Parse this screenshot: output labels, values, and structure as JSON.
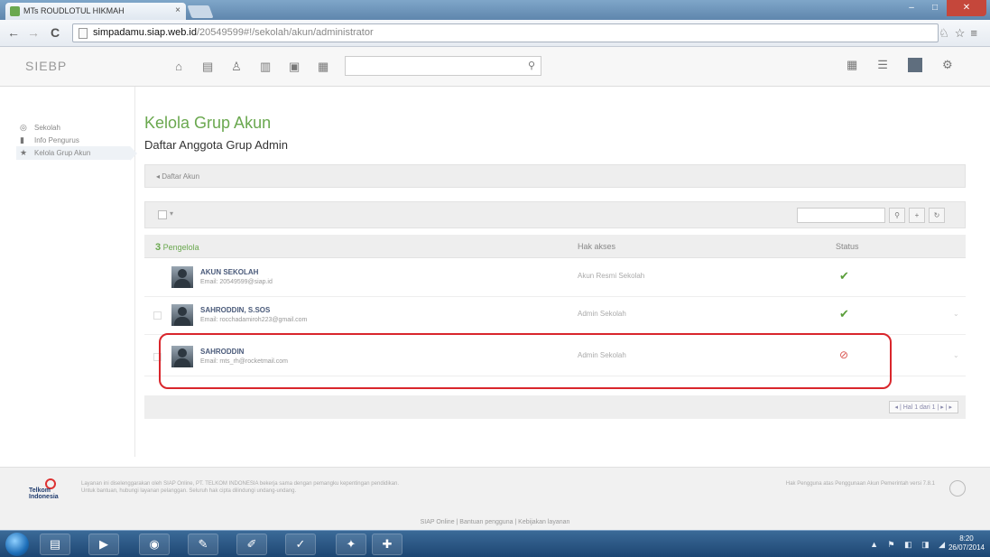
{
  "browser": {
    "tab_title": "MTs ROUDLOTUL HIKMAH",
    "tab_close": "×",
    "url_domain": "simpadamu.siap.web.id",
    "url_path": "/20549599#!/sekolah/akun/administrator",
    "nav_back": "←",
    "nav_forward": "→",
    "nav_reload": "C",
    "toolbar_right": "♘☆≡",
    "win_min": "–",
    "win_max": "□",
    "win_close": "✕"
  },
  "app": {
    "logo": "SIEBP",
    "nav_icons": [
      "home-icon",
      "book-icon",
      "users-icon",
      "calendar-icon",
      "document-icon",
      "building-icon"
    ],
    "nav_glyphs": [
      "⌂",
      "▤",
      "♙",
      "▥",
      "▣",
      "▦"
    ],
    "search_icon": "⚲",
    "right_glyphs": [
      "▦",
      "☰",
      "⚙"
    ]
  },
  "sidebar": {
    "items": [
      {
        "label": "Sekolah",
        "glyph": "◎"
      },
      {
        "label": "Info Pengurus",
        "glyph": "▮"
      },
      {
        "label": "Kelola Grup Akun",
        "glyph": "★"
      }
    ]
  },
  "main": {
    "title": "Kelola Grup Akun",
    "subtitle": "Daftar Anggota Grup Admin",
    "breadcrumb": "◂ Daftar Akun",
    "filter_buttons": [
      "⚲",
      "+",
      "↻"
    ],
    "table": {
      "count_number": "3",
      "count_label": "Pengelola",
      "col_role": "Hak akses",
      "col_status": "Status",
      "rows": [
        {
          "name": "AKUN SEKOLAH",
          "email": "Email: 20549599@siap.id",
          "role": "Akun Resmi Sekolah",
          "status": "✔",
          "status_kind": "ok",
          "menu": ""
        },
        {
          "name": "SAHRODDIN, S.SOS",
          "email": "Email: rocchadamiroh223@gmail.com",
          "role": "Admin Sekolah",
          "status": "✔",
          "status_kind": "ok",
          "menu": "⌄"
        },
        {
          "name": "SAHRODDIN",
          "email": "Email: mts_rh@rocketmail.com",
          "role": "Admin Sekolah",
          "status": "⊘",
          "status_kind": "bad",
          "menu": "⌄"
        }
      ]
    },
    "pager": "◂ | Hal 1 dari 1 | ▸ | ▸"
  },
  "footer": {
    "logo_text": "Telkom Indonesia",
    "text": "Layanan ini diselenggarakan oleh SIAP Online, PT. TELKOM INDONESIA bekerja sama dengan pemangku kepentingan pendidikan. Untuk bantuan, hubungi layanan pelanggan. Seluruh hak cipta dilindungi undang-undang.",
    "right_text": "Hak Pengguna atas Penggunaan Akun Pemerintah versi 7.8.1",
    "links": "SIAP Online | Bantuan pengguna | Kebijakan layanan"
  },
  "taskbar": {
    "apps": [
      "folder-icon",
      "media-icon",
      "chrome-icon",
      "paint-icon",
      "notes-icon",
      "paper-icon",
      "pdf-icon",
      "excel-icon"
    ],
    "app_glyphs": [
      "▤",
      "▶",
      "◉",
      "✎",
      "✐",
      "✓",
      "✦",
      "✚"
    ],
    "tray": "▲ ⚑ ◧ ◨ ◢",
    "time": "8:20",
    "date": "26/07/2014"
  }
}
